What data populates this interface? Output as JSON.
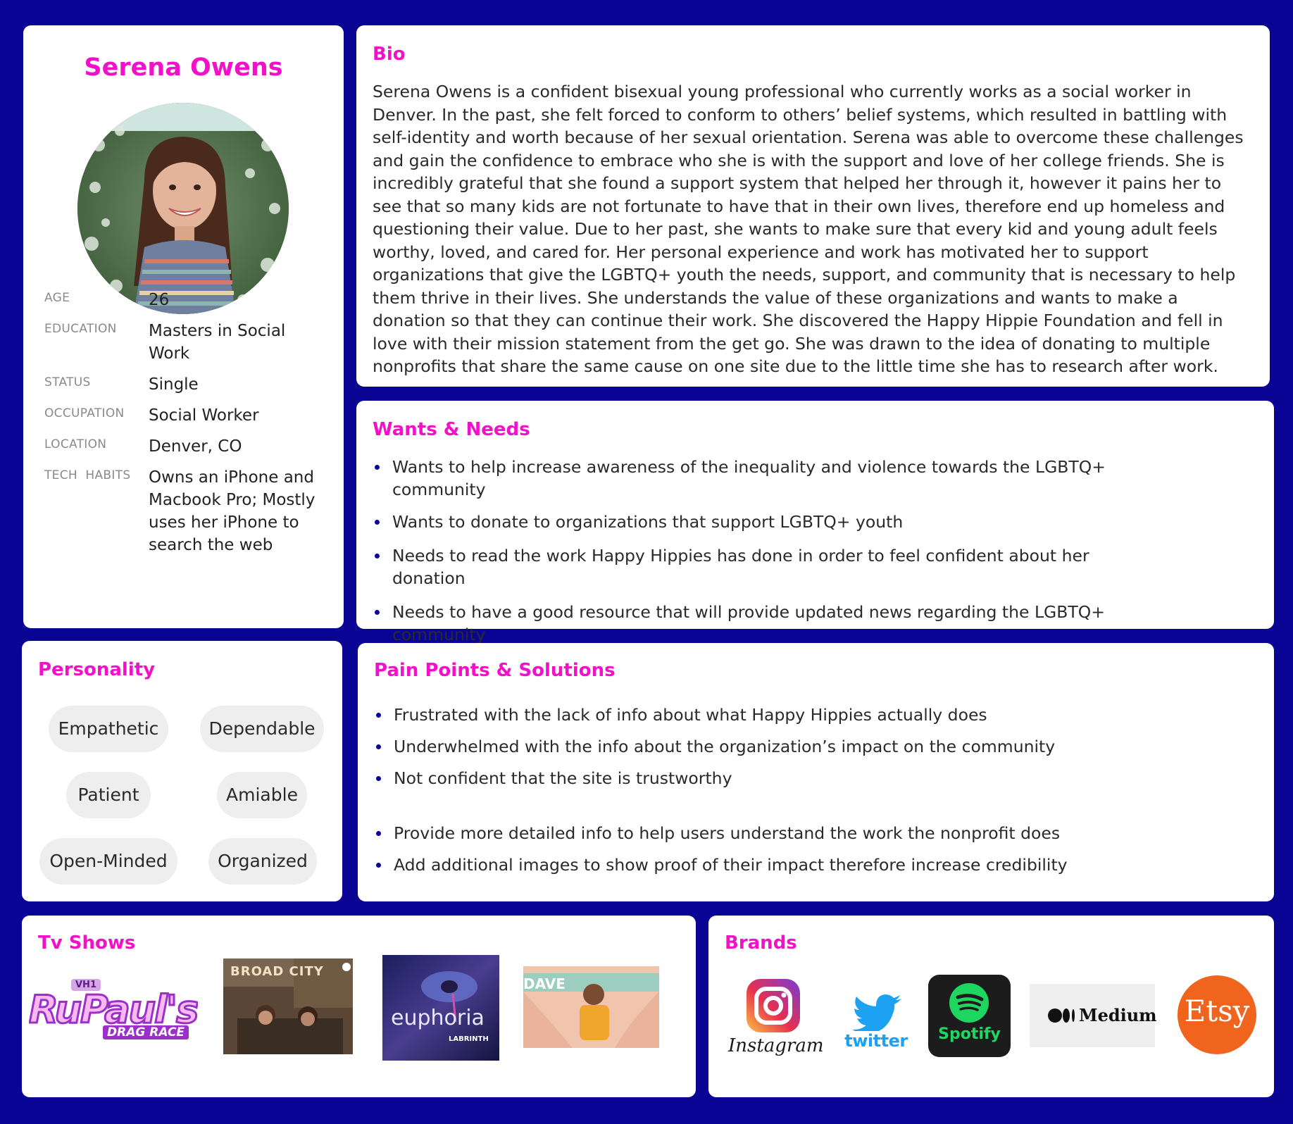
{
  "profile": {
    "name": "Serena Owens",
    "fields": [
      {
        "label": "AGE",
        "value": "26"
      },
      {
        "label": "EDUCATION",
        "value": "Masters in Social Work"
      },
      {
        "label": "STATUS",
        "value": "Single"
      },
      {
        "label": "OCCUPATION",
        "value": "Social Worker"
      },
      {
        "label": "LOCATION",
        "value": "Denver, CO"
      },
      {
        "label": "TECH  HABITS",
        "value": "Owns an iPhone and Macbook Pro; Mostly uses her iPhone to search the web"
      }
    ]
  },
  "bio": {
    "heading": "Bio",
    "text": "Serena Owens is a confident bisexual young professional who  currently works as a social worker in Denver. In the past, she felt forced to conform to others’ belief systems, which resulted in battling with self-identity and worth because of her sexual orientation. Serena was able to overcome these challenges and gain the confidence to embrace who she is with the support and love of her college friends. She is incredibly grateful that she found a support system that helped her through it, however it pains her to see that so many kids are not fortunate to have that in their own lives, therefore end up homeless and questioning their value. Due to her past, she wants to make sure that every kid and young adult feels worthy, loved, and cared for. Her personal experience and work has motivated her to support organizations that give the LGBTQ+ youth the needs, support, and community that is necessary to help them thrive in their lives. She understands the value of these organizations and wants to make a donation so that they can continue their work. She discovered the Happy Hippie Foundation and fell in love with their mission statement from the get go. She was drawn to the idea of donating to multiple nonprofits that share the same cause on one site due to the little time she has to research after work."
  },
  "wants": {
    "heading": "Wants & Needs",
    "items": [
      "Wants to help increase awareness of the inequality and violence towards the LGBTQ+ community",
      "Wants to donate to organizations that support LGBTQ+ youth",
      "Needs to read the work Happy Hippies has done in order to feel confident about her donation",
      "Needs to have a good resource that will provide updated news regarding the LGBTQ+ community"
    ]
  },
  "personality": {
    "heading": "Personality",
    "traits": [
      "Empathetic",
      "Dependable",
      "Patient",
      "Amiable",
      "Open-Minded",
      "Organized"
    ]
  },
  "pain": {
    "heading": "Pain Points & Solutions",
    "pain_points": [
      "Frustrated with the lack of info about what Happy Hippies actually does",
      "Underwhelmed with the info about the organization’s impact on the community",
      "Not confident that the site is trustworthy"
    ],
    "solutions": [
      "Provide more detailed info to help users understand the work the nonprofit does",
      "Add additional images to show proof of their impact therefore increase credibility"
    ]
  },
  "tv": {
    "heading": "Tv Shows",
    "rupaul_logo": {
      "badge": "VH1",
      "main": "RuPaul's",
      "sub": "DRAG RACE"
    },
    "broad_city": "BROAD CITY",
    "euphoria": {
      "title": "euphoria",
      "credit": "LABRINTH"
    },
    "dave": "DAVE"
  },
  "brands": {
    "heading": "Brands",
    "instagram": "Instagram",
    "twitter": "twitter",
    "spotify": "Spotify",
    "medium": "Medium",
    "etsy": "Etsy"
  },
  "colors": {
    "background": "#0a0495",
    "accent": "#f211c8",
    "card": "#ffffff",
    "chip": "#eeeeee"
  }
}
